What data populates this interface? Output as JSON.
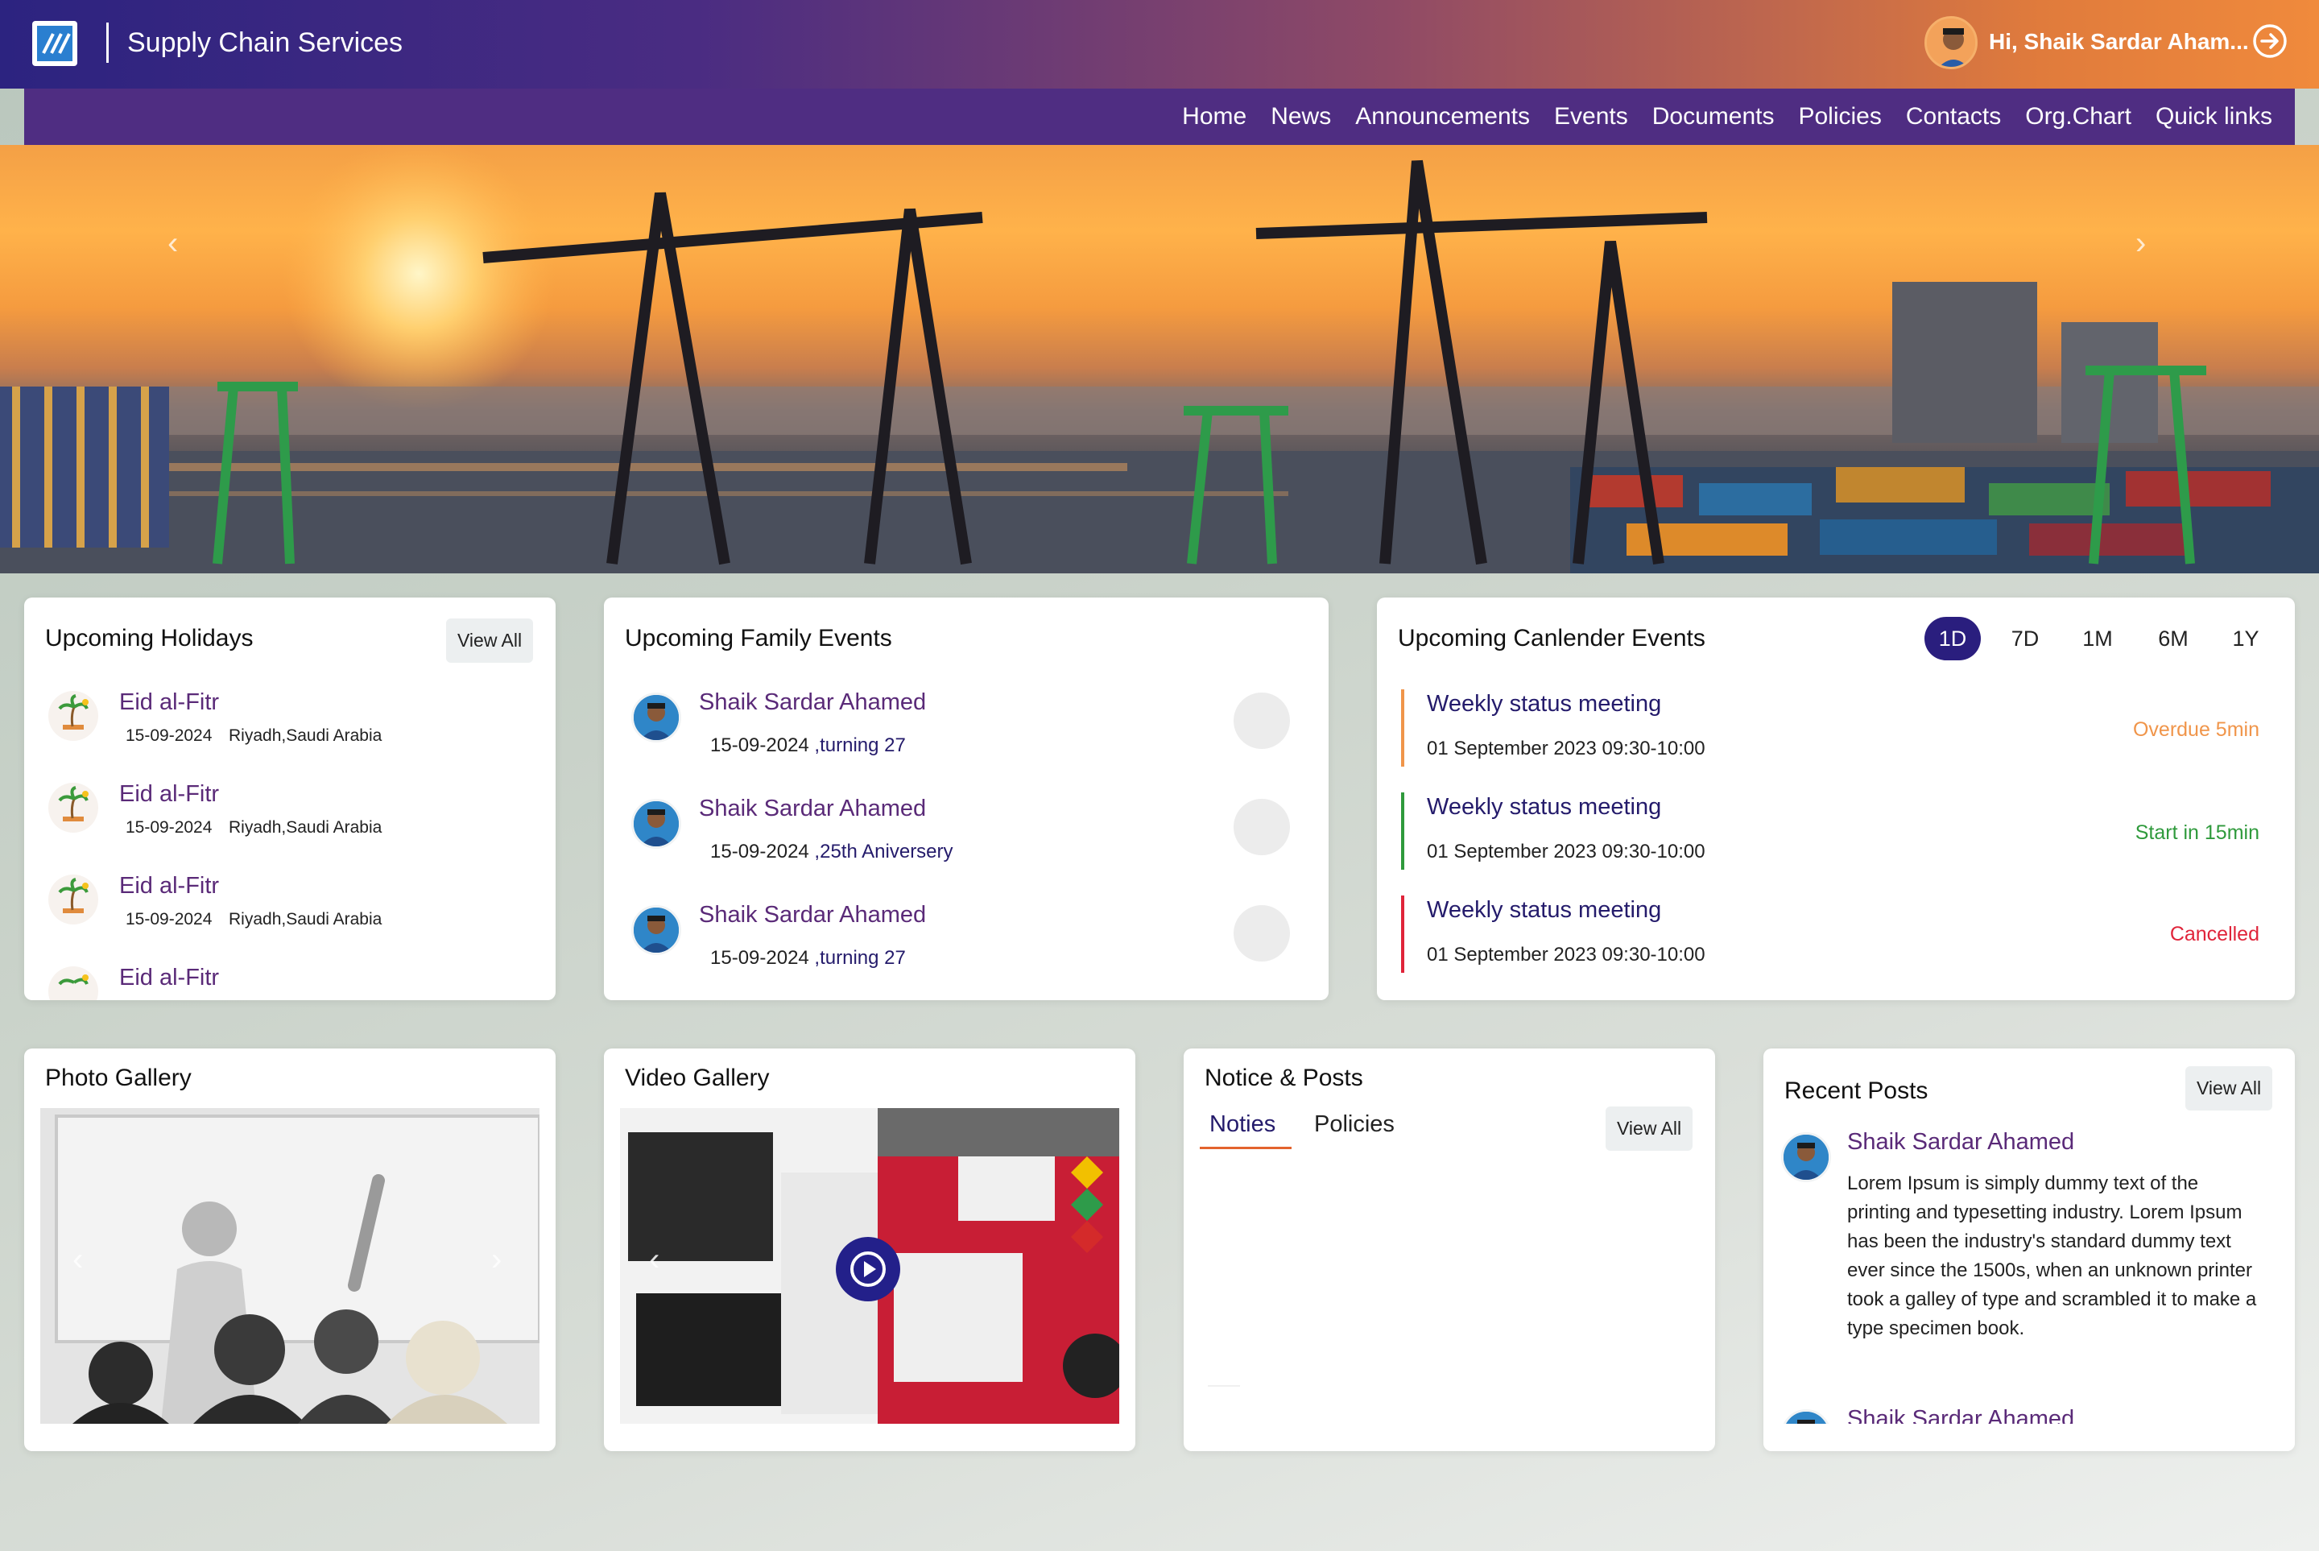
{
  "header": {
    "title": "Supply Chain Services",
    "greeting": "Hi, Shaik Sardar Aham...",
    "logo_icon": "brand-logo-icon",
    "logout_icon": "logout-icon"
  },
  "nav": {
    "items": [
      "Home",
      "News",
      "Announcements",
      "Events",
      "Documents",
      "Policies",
      "Contacts",
      "Org.Chart",
      "Quick links"
    ]
  },
  "hero": {
    "prev": "‹",
    "next": "›"
  },
  "holidays": {
    "title": "Upcoming Holidays",
    "view_all": "View All",
    "items": [
      {
        "name": "Eid al-Fitr",
        "date": "15-09-2024",
        "place": "Riyadh,Saudi Arabia"
      },
      {
        "name": "Eid al-Fitr",
        "date": "15-09-2024",
        "place": "Riyadh,Saudi Arabia"
      },
      {
        "name": "Eid al-Fitr",
        "date": "15-09-2024",
        "place": "Riyadh,Saudi Arabia"
      },
      {
        "name": "Eid al-Fitr",
        "date": "",
        "place": ""
      }
    ]
  },
  "family_events": {
    "title": "Upcoming Family Events",
    "items": [
      {
        "name": "Shaik Sardar Ahamed",
        "date": "15-09-2024",
        "detail": " ,turning 27"
      },
      {
        "name": "Shaik Sardar Ahamed",
        "date": "15-09-2024",
        "detail": " ,25th Aniversery"
      },
      {
        "name": "Shaik Sardar Ahamed",
        "date": "15-09-2024",
        "detail": " ,turning 27"
      }
    ]
  },
  "calendar_events": {
    "title": "Upcoming Canlender Events",
    "ranges": [
      "1D",
      "7D",
      "1M",
      "6M",
      "1Y"
    ],
    "active_range": "1D",
    "items": [
      {
        "title": "Weekly status meeting",
        "date": "01 September 2023 09:30-10:00",
        "status": "Overdue 5min",
        "color": "#f0954a"
      },
      {
        "title": "Weekly status meeting",
        "date": "01 September 2023 09:30-10:00",
        "status": "Start in 15min",
        "color": "#2f9a3c"
      },
      {
        "title": "Weekly status meeting",
        "date": "01 September 2023 09:30-10:00",
        "status": "Cancelled",
        "color": "#e0243a"
      }
    ]
  },
  "photo_gallery": {
    "title": "Photo Gallery",
    "prev": "‹",
    "next": "›"
  },
  "video_gallery": {
    "title": "Video Gallery",
    "prev": "‹",
    "play_icon": "play-icon"
  },
  "notices": {
    "title": "Notice & Posts",
    "tabs": [
      "Noties",
      "Policies"
    ],
    "active_tab": "Noties",
    "view_all": "View All"
  },
  "recent_posts": {
    "title": "Recent Posts",
    "view_all": "View All",
    "items": [
      {
        "name": "Shaik Sardar Ahamed",
        "text": "Lorem Ipsum is simply dummy text of the printing and typesetting industry. Lorem Ipsum has been the industry's standard dummy text ever since the 1500s, when an unknown printer took a galley of type and scrambled it to make a type specimen book."
      },
      {
        "name": "Shaik Sardar Ahamed",
        "text": ""
      }
    ]
  },
  "colors": {
    "header_start": "#2c2380",
    "header_end": "#f08a3c",
    "nav_bg": "#4f2d82",
    "accent_purple": "#5a2a78",
    "accent_navy": "#241b6b",
    "active_range": "#2a1e7e"
  }
}
